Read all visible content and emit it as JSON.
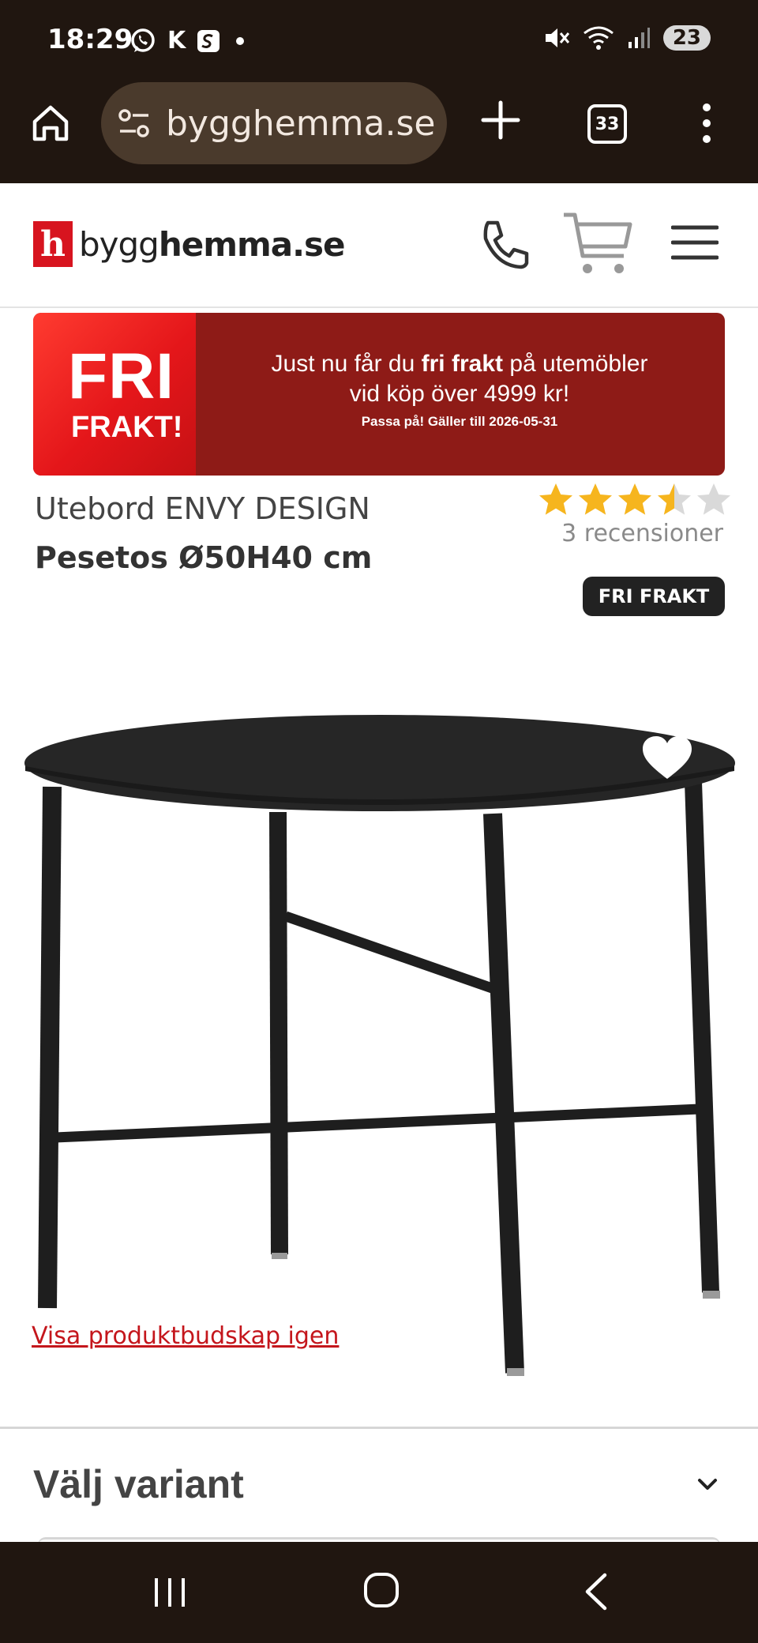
{
  "status_bar": {
    "time": "18:29",
    "carrier_letter": "K",
    "battery": "23"
  },
  "browser": {
    "url": "bygghemma.se",
    "tab_count": "33"
  },
  "header": {
    "logo_letter": "h",
    "logo_text_regular": "bygg",
    "logo_text_bold": "hemma.se"
  },
  "promo": {
    "big_label": "FRI",
    "small_label": "FRAKT!",
    "line1_pre": "Just nu får du ",
    "line1_bold": "fri frakt",
    "line1_post": " på utemöbler",
    "line2": "vid köp över 4999 kr!",
    "small_print": "Passa på! Gäller till 2026-05-31"
  },
  "product": {
    "brand": "Utebord ENVY DESIGN",
    "name": "Pesetos Ø50H40 cm",
    "rating": 3.5,
    "rating_max": 5,
    "reviews_text": "3 recensioner",
    "badge": "FRI FRAKT",
    "show_message_link": "Visa produktbudskap igen"
  },
  "variant": {
    "title": "Välj variant"
  },
  "colors": {
    "brand_red": "#d7141f",
    "star_fill": "#f6b51e",
    "star_empty": "#d9d9d9",
    "chrome_dark": "#201610"
  }
}
